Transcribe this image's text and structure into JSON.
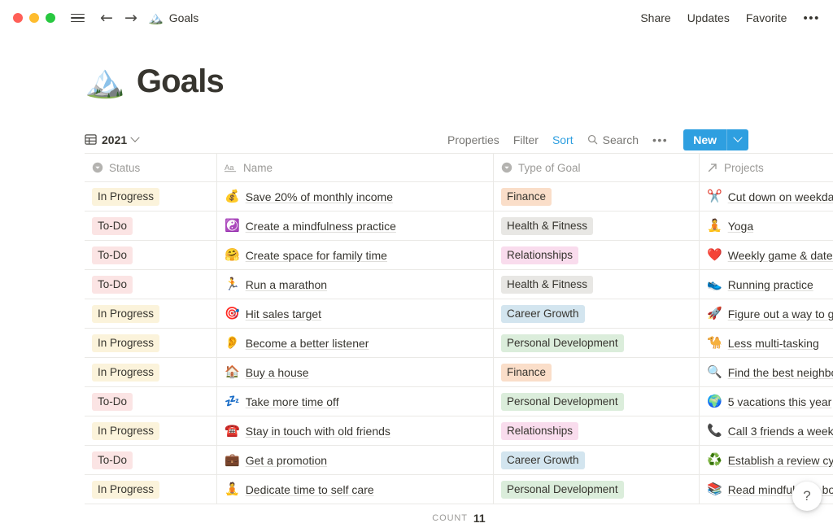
{
  "window": {
    "traffic_lights": [
      "close",
      "minimize",
      "maximize"
    ],
    "menu_icon": "hamburger-icon",
    "back_icon": "←",
    "forward_icon": "→",
    "breadcrumb": {
      "emoji": "🏔️",
      "label": "Goals"
    }
  },
  "topbar_right": {
    "share": "Share",
    "updates": "Updates",
    "favorite": "Favorite",
    "more": "•••"
  },
  "page": {
    "emoji": "🏔️",
    "title": "Goals"
  },
  "view": {
    "name": "2021",
    "icon": "table-icon"
  },
  "toolbar": {
    "properties": "Properties",
    "filter": "Filter",
    "sort": "Sort",
    "search": "Search",
    "more": "•••",
    "new": "New",
    "accent_color": "#2e9fe0",
    "active_item": "Sort"
  },
  "table": {
    "columns": [
      {
        "label": "Status",
        "icon": "select-icon"
      },
      {
        "label": "Name",
        "icon": "text-icon"
      },
      {
        "label": "Type of Goal",
        "icon": "select-icon"
      },
      {
        "label": "Projects",
        "icon": "relation-icon"
      }
    ],
    "rows": [
      {
        "status": "In Progress",
        "status_class": "tag-inprogress",
        "name_emoji": "💰",
        "name": "Save 20% of monthly income",
        "type": "Finance",
        "type_class": "tag-finance",
        "project_emoji": "✂️",
        "project": "Cut down on weekday spending"
      },
      {
        "status": "To-Do",
        "status_class": "tag-todo",
        "name_emoji": "☯️",
        "name": "Create a mindfulness practice",
        "type": "Health & Fitness",
        "type_class": "tag-health",
        "project_emoji": "🧘",
        "project": "Yoga"
      },
      {
        "status": "To-Do",
        "status_class": "tag-todo",
        "name_emoji": "🤗",
        "name": "Create space for family time",
        "type": "Relationships",
        "type_class": "tag-relationships",
        "project_emoji": "❤️",
        "project": "Weekly game & date night"
      },
      {
        "status": "To-Do",
        "status_class": "tag-todo",
        "name_emoji": "🏃",
        "name": "Run a marathon",
        "type": "Health & Fitness",
        "type_class": "tag-health",
        "project_emoji": "👟",
        "project": "Running practice"
      },
      {
        "status": "In Progress",
        "status_class": "tag-inprogress",
        "name_emoji": "🎯",
        "name": "Hit sales target",
        "type": "Career Growth",
        "type_class": "tag-career",
        "project_emoji": "🚀",
        "project": "Figure out a way to grow"
      },
      {
        "status": "In Progress",
        "status_class": "tag-inprogress",
        "name_emoji": "👂",
        "name": "Become a better listener",
        "type": "Personal Development",
        "type_class": "tag-personal",
        "project_emoji": "🐪",
        "project": "Less multi-tasking"
      },
      {
        "status": "In Progress",
        "status_class": "tag-inprogress",
        "name_emoji": "🏠",
        "name": "Buy a house",
        "type": "Finance",
        "type_class": "tag-finance",
        "project_emoji": "🔍",
        "project": "Find the best neighborhood"
      },
      {
        "status": "To-Do",
        "status_class": "tag-todo",
        "name_emoji": "💤",
        "name": "Take more time off",
        "type": "Personal Development",
        "type_class": "tag-personal",
        "project_emoji": "🌍",
        "project": "5 vacations this year"
      },
      {
        "status": "In Progress",
        "status_class": "tag-inprogress",
        "name_emoji": "☎️",
        "name": "Stay in touch with old friends",
        "type": "Relationships",
        "type_class": "tag-relationships",
        "project_emoji": "📞",
        "project": "Call 3 friends a week"
      },
      {
        "status": "To-Do",
        "status_class": "tag-todo",
        "name_emoji": "💼",
        "name": "Get a promotion",
        "type": "Career Growth",
        "type_class": "tag-career",
        "project_emoji": "♻️",
        "project": "Establish a review cycle"
      },
      {
        "status": "In Progress",
        "status_class": "tag-inprogress",
        "name_emoji": "🧘",
        "name": "Dedicate time to self care",
        "type": "Personal Development",
        "type_class": "tag-personal",
        "project_emoji": "📚",
        "project": "Read mindfulness books"
      }
    ]
  },
  "footer": {
    "count_label": "COUNT",
    "count_value": "11"
  },
  "help": {
    "label": "?"
  }
}
